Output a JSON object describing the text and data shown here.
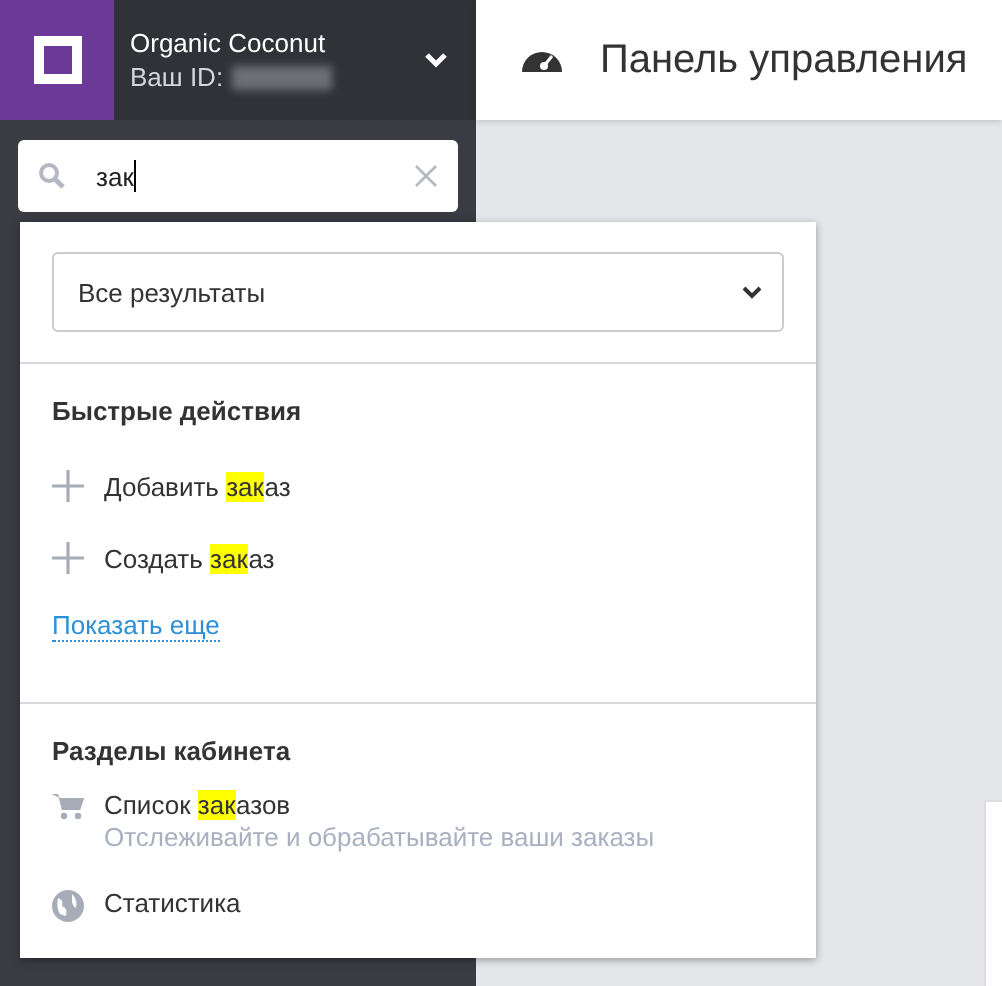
{
  "account": {
    "name": "Organic Coconut",
    "id_label": "Ваш ID:"
  },
  "header": {
    "title": "Панель управления"
  },
  "search": {
    "value": "зак"
  },
  "dropdown": {
    "filter": "Все результаты",
    "quick_actions": {
      "title": "Быстрые действия",
      "items": [
        {
          "before": "Добавить ",
          "match": "зак",
          "after": "аз"
        },
        {
          "before": "Создать ",
          "match": "зак",
          "after": "аз"
        }
      ],
      "more_link": "Показать еще"
    },
    "sections": {
      "title": "Разделы кабинета",
      "items": [
        {
          "kind": "cart",
          "before": "Список ",
          "match": "зак",
          "after": "азов",
          "description": "Отслеживайте и обрабатывайте ваши заказы"
        },
        {
          "kind": "globe",
          "before": "Статистика"
        }
      ]
    }
  }
}
